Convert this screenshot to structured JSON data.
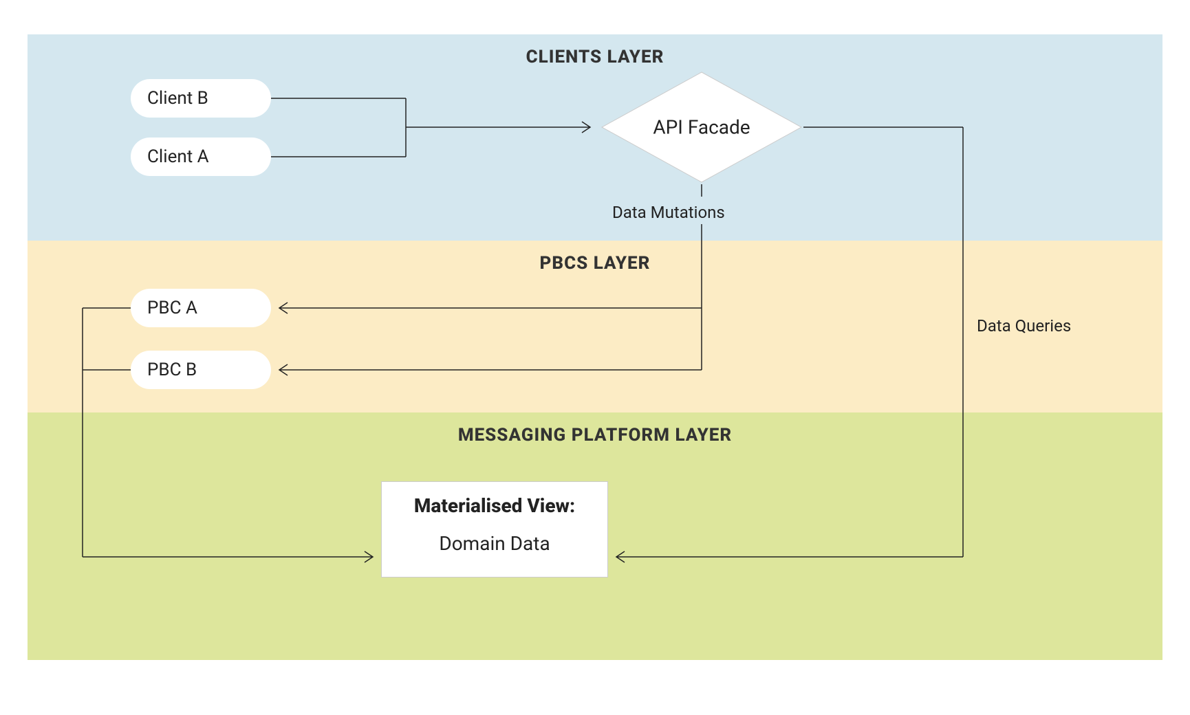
{
  "layers": {
    "clients": {
      "title": "CLIENTS LAYER",
      "color": "#d4e7ef",
      "nodes": {
        "client_b": "Client B",
        "client_a": "Client A",
        "api_facade": "API Facade"
      }
    },
    "pbcs": {
      "title": "PBCS LAYER",
      "color": "#fcecc5",
      "nodes": {
        "pbc_a": "PBC A",
        "pbc_b": "PBC B"
      }
    },
    "messaging": {
      "title": "MESSAGING PLATFORM LAYER",
      "color": "#dde69c",
      "nodes": {
        "mv_title": "Materialised View:",
        "mv_sub": "Domain Data"
      }
    }
  },
  "edge_labels": {
    "data_mutations": "Data Mutations",
    "data_queries": "Data Queries"
  },
  "chart_data": {
    "type": "layered-architecture-diagram",
    "layers": [
      {
        "id": "clients",
        "title": "CLIENTS LAYER",
        "nodes": [
          "Client B",
          "Client A",
          "API Facade"
        ]
      },
      {
        "id": "pbcs",
        "title": "PBCS LAYER",
        "nodes": [
          "PBC A",
          "PBC B"
        ]
      },
      {
        "id": "messaging",
        "title": "MESSAGING PLATFORM LAYER",
        "nodes": [
          "Materialised View: Domain Data"
        ]
      }
    ],
    "edges": [
      {
        "from": "Client B",
        "to": "API Facade",
        "label": null,
        "directed": true
      },
      {
        "from": "Client A",
        "to": "API Facade",
        "label": null,
        "directed": true
      },
      {
        "from": "API Facade",
        "to": "PBC A",
        "label": "Data Mutations",
        "directed": true
      },
      {
        "from": "API Facade",
        "to": "PBC B",
        "label": "Data Mutations",
        "directed": true
      },
      {
        "from": "API Facade",
        "to": "Materialised View: Domain Data",
        "label": "Data Queries",
        "directed": true
      },
      {
        "from": "PBC A",
        "to": "Materialised View: Domain Data",
        "label": null,
        "directed": true
      },
      {
        "from": "PBC B",
        "to": "Materialised View: Domain Data",
        "label": null,
        "directed": true
      }
    ]
  }
}
